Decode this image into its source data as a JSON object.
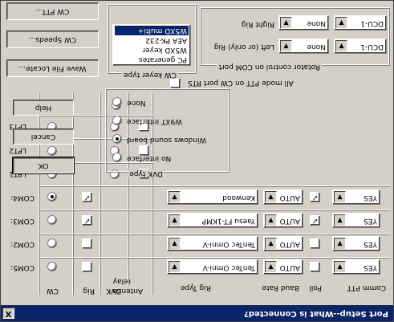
{
  "window": {
    "title": "Port Setup--What is Connected?",
    "close_glyph": "X"
  },
  "headers": {
    "comm_ptt": "Comm PTT",
    "poll": "Poll",
    "baud_rate": "Baud Rate",
    "rig_type": "Rig Type",
    "antenna_relay_line1": "Antenna",
    "antenna_relay_line2": "relay",
    "dvk": "DVK",
    "rig": "Rig",
    "cw": "CW"
  },
  "com_ports": [
    {
      "label": "COM5:",
      "ptt": "YES",
      "poll": false,
      "baud": "AUTO",
      "rig_type": "TenTec Omni-V",
      "rig": false,
      "cw": false
    },
    {
      "label": "COM2:",
      "ptt": "YES",
      "poll": false,
      "baud": "AUTO",
      "rig_type": "TenTec Omni-V",
      "rig": false,
      "cw": false
    },
    {
      "label": "COM3:",
      "ptt": "YES",
      "poll": true,
      "baud": "AUTO",
      "rig_type": "Yaesu FT-1KMP",
      "rig": true,
      "cw": false
    },
    {
      "label": "COM4:",
      "ptt": "YES",
      "poll": true,
      "baud": "AUTO",
      "rig_type": "Kenwood",
      "rig": true,
      "cw": true
    }
  ],
  "lpt_ports": [
    {
      "label": "LPT1",
      "antenna": false,
      "dvk": false,
      "cw": false
    },
    {
      "label": "LPT2",
      "antenna": false,
      "dvk": false,
      "cw": false
    },
    {
      "label": "LPT3",
      "antenna": false,
      "dvk": false,
      "cw": false
    }
  ],
  "buttons": {
    "ok": "OK",
    "cancel": "Cancel",
    "help": "Help",
    "wave_file_locate": "Wave File Locate...",
    "cw_speeds": "CW Speeds...",
    "cw_ptt": "CW PTT..."
  },
  "dvk_type": {
    "label": "DVK type",
    "options": [
      {
        "label": "No interface",
        "selected": false
      },
      {
        "label": "Windows sound board",
        "selected": true
      },
      {
        "label": "W9XT interface",
        "selected": false
      },
      {
        "label": "None",
        "selected": false
      }
    ]
  },
  "all_mode_ptt": {
    "label": "All mode PTT on CW port RTS",
    "checked": false
  },
  "cw_keyer_type": {
    "label": "CW keyer type",
    "items": [
      {
        "label": "PC generates",
        "selected": false
      },
      {
        "label": "W5XD keyer",
        "selected": false
      },
      {
        "label": "AEA PK-232",
        "selected": false
      },
      {
        "label": "W5XD multi+",
        "selected": true
      }
    ]
  },
  "rotator": {
    "label": "Rotator control on COM port",
    "left_rig_label": "Left (or only) Rig",
    "right_rig_label": "Right Rig",
    "left_model": "None",
    "left_port": "DCU-1",
    "right_model": "None",
    "right_port": "DCU-1"
  },
  "colors": {
    "face": "#d4d0c8",
    "title_bar": "#0a246a",
    "selection": "#0a246a"
  }
}
